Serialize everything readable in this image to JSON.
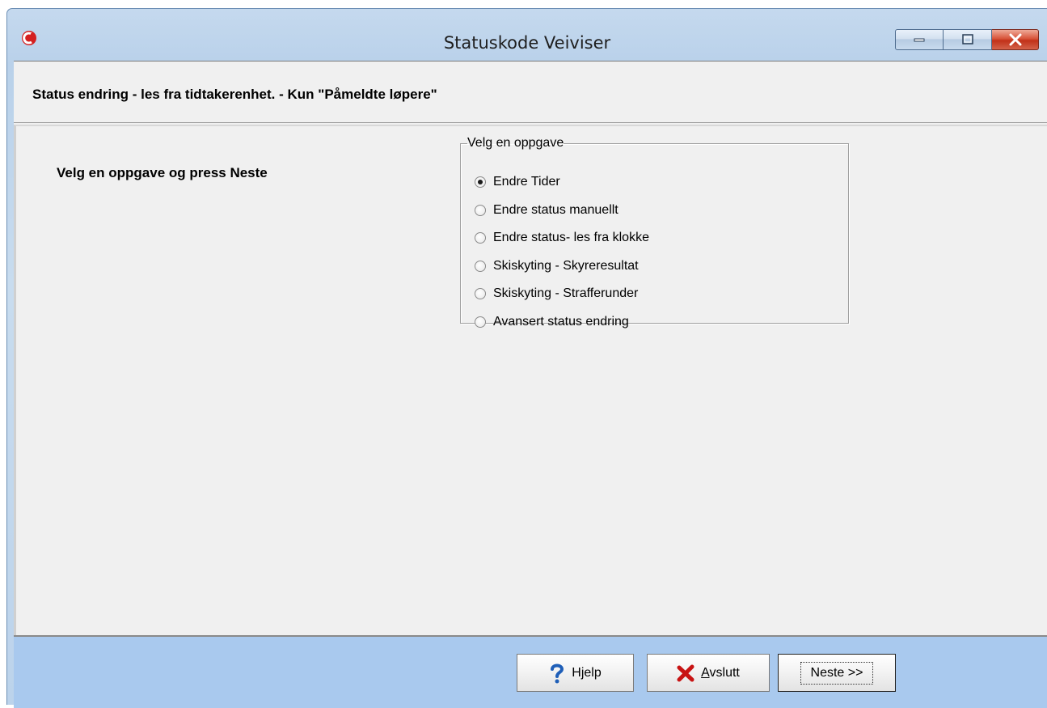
{
  "window": {
    "title": "Statuskode Veiviser",
    "app_icon": "app-logo-icon",
    "caption_buttons": [
      "minimize-icon",
      "maximize-icon",
      "close-icon"
    ]
  },
  "header": {
    "text": "Status endring - les fra tidtakerenhet. - Kun \"Påmeldte løpere\""
  },
  "main": {
    "instruction": "Velg en oppgave og press Neste",
    "group_title": "Velg en oppgave",
    "options": [
      {
        "label": "Endre Tider",
        "checked": true
      },
      {
        "label": "Endre status manuellt",
        "checked": false
      },
      {
        "label": "Endre status- les fra klokke",
        "checked": false
      },
      {
        "label": "Skiskyting - Skyreresultat",
        "checked": false
      },
      {
        "label": "Skiskyting - Strafferunder",
        "checked": false
      },
      {
        "label": "Avansert status endring",
        "checked": false
      }
    ]
  },
  "footer": {
    "help_label": "Hjelp",
    "quit_label_rest": "vslutt",
    "quit_label_accel": "A",
    "next_label": "Neste >>"
  },
  "colors": {
    "footer_bg": "#a9c9ee",
    "window_frame": "#c5d9ee",
    "close_button": "#c13119",
    "quit_icon": "#c81414",
    "help_icon": "#1f5fb8"
  }
}
